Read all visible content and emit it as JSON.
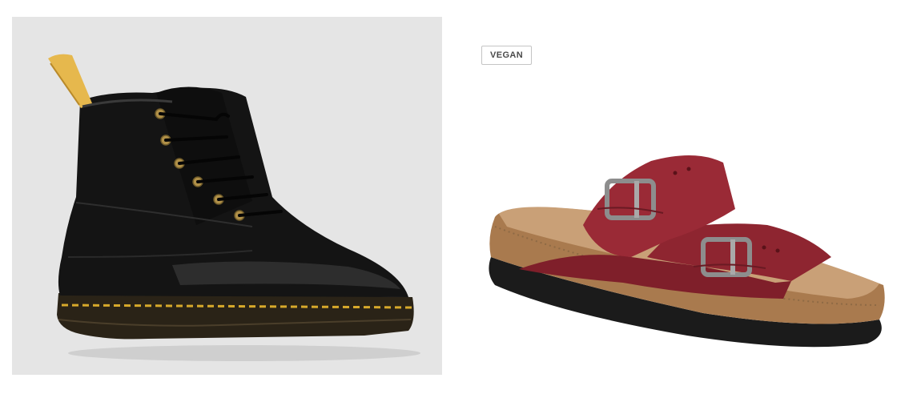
{
  "products": [
    {
      "image_alt": "",
      "badge": "",
      "colors": {
        "background": "#e5e5e5",
        "leather": "#141414",
        "stitching": "#d7a92b",
        "pull_tab": "#e6b84d"
      }
    },
    {
      "image_alt": "",
      "badge": "VEGAN",
      "colors": {
        "background": "#ffffff",
        "strap": "#8e2530",
        "footbed": "#c29769",
        "sole": "#1b1b1b",
        "buckle": "#8d8d8d"
      }
    }
  ]
}
